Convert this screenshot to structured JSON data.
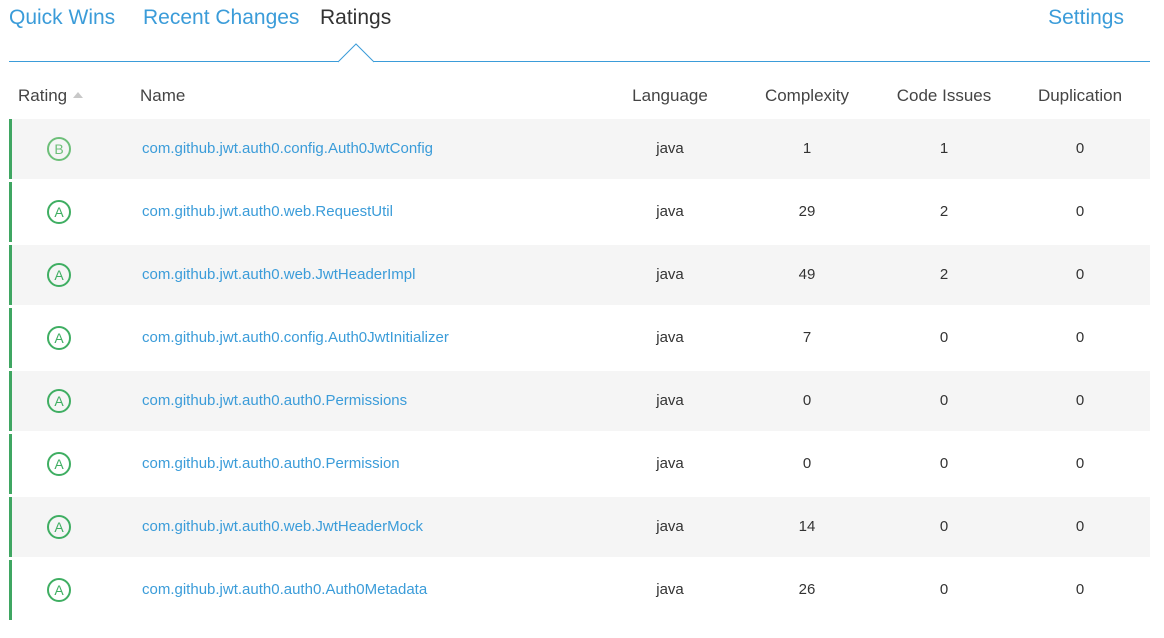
{
  "tabs": {
    "quick_wins": "Quick Wins",
    "recent_changes": "Recent Changes",
    "ratings": "Ratings",
    "settings": "Settings",
    "active": "Ratings"
  },
  "table": {
    "headers": {
      "rating": "Rating",
      "name": "Name",
      "language": "Language",
      "complexity": "Complexity",
      "code_issues": "Code Issues",
      "duplication": "Duplication"
    },
    "sort": {
      "column": "Rating",
      "direction": "ascending",
      "icon": "sort-up-icon"
    },
    "rows": [
      {
        "rating": "B",
        "name": "com.github.jwt.auth0.config.Auth0JwtConfig",
        "language": "java",
        "complexity": "1",
        "code_issues": "1",
        "duplication": "0"
      },
      {
        "rating": "A",
        "name": "com.github.jwt.auth0.web.RequestUtil",
        "language": "java",
        "complexity": "29",
        "code_issues": "2",
        "duplication": "0"
      },
      {
        "rating": "A",
        "name": "com.github.jwt.auth0.web.JwtHeaderImpl",
        "language": "java",
        "complexity": "49",
        "code_issues": "2",
        "duplication": "0"
      },
      {
        "rating": "A",
        "name": "com.github.jwt.auth0.config.Auth0JwtInitializer",
        "language": "java",
        "complexity": "7",
        "code_issues": "0",
        "duplication": "0"
      },
      {
        "rating": "A",
        "name": "com.github.jwt.auth0.auth0.Permissions",
        "language": "java",
        "complexity": "0",
        "code_issues": "0",
        "duplication": "0"
      },
      {
        "rating": "A",
        "name": "com.github.jwt.auth0.auth0.Permission",
        "language": "java",
        "complexity": "0",
        "code_issues": "0",
        "duplication": "0"
      },
      {
        "rating": "A",
        "name": "com.github.jwt.auth0.web.JwtHeaderMock",
        "language": "java",
        "complexity": "14",
        "code_issues": "0",
        "duplication": "0"
      },
      {
        "rating": "A",
        "name": "com.github.jwt.auth0.auth0.Auth0Metadata",
        "language": "java",
        "complexity": "26",
        "code_issues": "0",
        "duplication": "0"
      }
    ]
  },
  "colors": {
    "link": "#3b9cd9",
    "grade_a": "#3fae62",
    "grade_b": "#6dbf79",
    "row_border": "#3fa662",
    "row_shade": "#f5f5f5"
  }
}
